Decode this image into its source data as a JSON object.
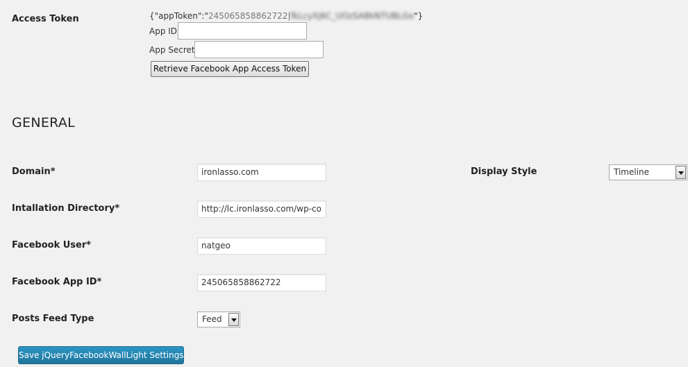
{
  "access_token": {
    "label": "Access Token",
    "token_open": "{\"appToken\":\"",
    "token_id": "245065858862722",
    "token_pipe": "|",
    "token_secret_blurred": "fkLcyXj6C_UOzSABkNTUBLGo",
    "token_close": "\"}",
    "app_id_label": "App ID",
    "app_id_value": "",
    "app_secret_label": "App Secret",
    "app_secret_value": "",
    "retrieve_button": "Retrieve Facebook App Access Token"
  },
  "general": {
    "heading": "GENERAL",
    "domain_label": "Domain*",
    "domain_value": "ironlasso.com",
    "install_dir_label": "Intallation Directory*",
    "install_dir_value": "http://lc.ironlasso.com/wp-co",
    "fb_user_label": "Facebook User*",
    "fb_user_value": "natgeo",
    "fb_app_id_label": "Facebook App ID*",
    "fb_app_id_value": "245065858862722",
    "posts_feed_type_label": "Posts Feed Type",
    "posts_feed_type_selected": "Feed",
    "display_style_label": "Display Style",
    "display_style_selected": "Timeline"
  },
  "save_button": "Save jQueryFacebookWallLight Settings",
  "colors": {
    "background": "#f1f1f1",
    "primary_button": "#21759b"
  }
}
